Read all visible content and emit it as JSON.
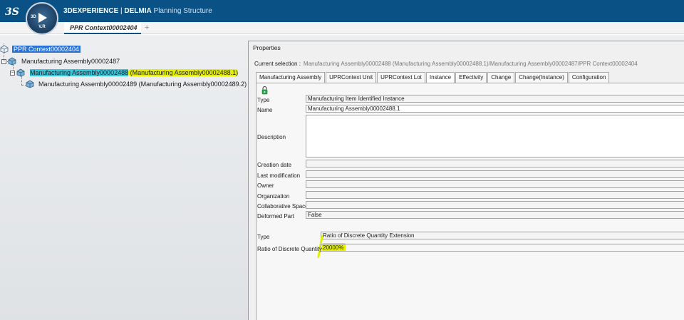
{
  "app": {
    "brand_bold": "3DEXPERIENCE",
    "brand_sep": " | ",
    "brand_product": "DELMIA",
    "brand_app": " Planning Structure",
    "compass_top_left": "3D",
    "compass_version": "V.R"
  },
  "tabs": {
    "active": "PPR Context00002404",
    "add_label": "+"
  },
  "tree": {
    "root": "PPR Context00002404",
    "level1": "Manufacturing Assembly00002487",
    "level2_name": "Manufacturing Assembly00002488",
    "level2_instance": " (Manufacturing Assembly00002488.1)",
    "level3": "Manufacturing Assembly00002489 (Manufacturing Assembly00002489.2)"
  },
  "properties": {
    "title": "Properties",
    "current_selection_label": "Current selection :",
    "current_selection_value": "Manufacturing Assembly00002488 (Manufacturing Assembly00002488.1)/Manufacturing Assembly00002487/PPR Context00002404",
    "tabs": [
      "Manufacturing Assembly",
      "UPRContext Unit",
      "UPRContext Lot",
      "Instance",
      "Effectivity",
      "Change",
      "Change(Instance)",
      "Configuration"
    ],
    "active_tab": "Instance",
    "fields": {
      "type_label": "Type",
      "type_value": "Manufacturing Item Identified Instance",
      "name_label": "Name",
      "name_value": "Manufacturing Assembly00002488.1",
      "description_label": "Description",
      "description_value": "",
      "creation_date_label": "Creation date",
      "last_modification_label": "Last modification",
      "owner_label": "Owner",
      "organization_label": "Organization",
      "collab_space_label": "Collaborative Space",
      "deformed_part_label": "Deformed Part",
      "deformed_part_value": "False"
    },
    "extension": {
      "type_label": "Type",
      "type_value": "Ratio of Discrete Quantity Extension",
      "ratio_label": "Ratio of Discrete Quantity",
      "ratio_value": "20000%"
    }
  },
  "colors": {
    "topbar": "#0a5286",
    "selection_blue": "#2a73d5",
    "highlight_cyan": "#34c8e0",
    "highlight_yellow": "#e5f000",
    "highlight_green": "#62d860"
  },
  "icons": [
    "3ds-logo-icon",
    "compass-icon",
    "root-product-icon",
    "assembly-icon",
    "status-icon"
  ]
}
